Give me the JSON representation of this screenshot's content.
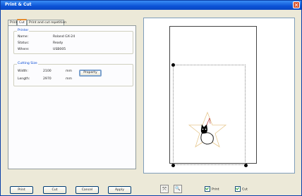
{
  "window": {
    "title": "Print & Cut",
    "close_glyph": "✕"
  },
  "tabs": [
    {
      "label": "Print",
      "active": false
    },
    {
      "label": "Cut",
      "active": true
    },
    {
      "label": "Print and cut repetition",
      "active": false
    }
  ],
  "printer": {
    "group_label": "Printer",
    "name_label": "Name:",
    "name_value": "Roland GX-24",
    "status_label": "Status:",
    "status_value": "Ready",
    "where_label": "Where:",
    "where_value": "USB005"
  },
  "cutting_size": {
    "group_label": "Cutting Size",
    "width_label": "Width:",
    "width_value": "2100",
    "width_unit": "mm",
    "length_label": "Length:",
    "length_value": "2970",
    "length_unit": "mm",
    "property_button": "Property"
  },
  "buttons": {
    "print": "Print",
    "cut": "Cut",
    "cancel": "Cancel",
    "apply": "Apply"
  },
  "tools": {
    "fit_icon": "fit-page-icon",
    "zoom_icon": "zoom-icon",
    "fit_glyph": "⤧",
    "zoom_glyph": "🔍"
  },
  "options": {
    "print_label": "Print",
    "print_checked": true,
    "cut_label": "Cut",
    "cut_checked": true
  },
  "colors": {
    "title_bar": "#0b52d6",
    "window_bg": "#ece9d8",
    "group_label": "#0046d5",
    "star_outline": "#e6c88f"
  }
}
